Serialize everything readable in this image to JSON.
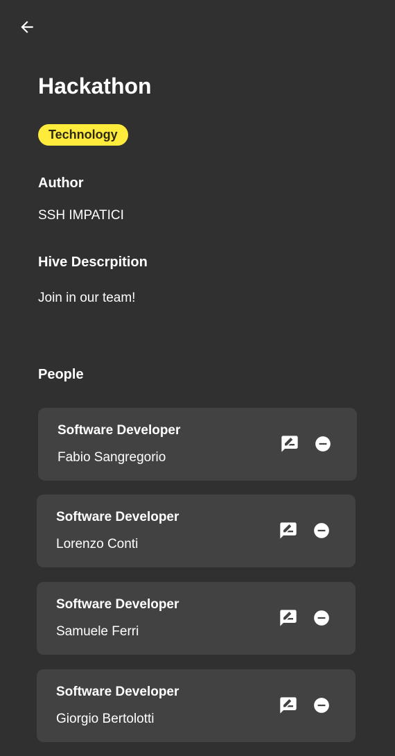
{
  "header": {
    "back_icon": "arrow-left-icon"
  },
  "hive": {
    "title": "Hackathon",
    "category": "Technology",
    "category_color": "#FFEB3B",
    "author_heading": "Author",
    "author": "SSH IMPATICI",
    "description_heading": "Hive Descrpition",
    "description": "Join in our team!"
  },
  "people": {
    "heading": "People",
    "edit_icon": "rate-review-icon",
    "remove_icon": "remove-circle-icon",
    "items": [
      {
        "role": "Software Developer",
        "name": "Fabio Sangregorio"
      },
      {
        "role": "Software Developer",
        "name": "Lorenzo Conti"
      },
      {
        "role": "Software Developer",
        "name": "Samuele Ferri"
      },
      {
        "role": "Software Developer",
        "name": "Giorgio Bertolotti"
      }
    ]
  },
  "colors": {
    "background": "#303030",
    "card": "#424242",
    "text": "#FFFFFF"
  }
}
